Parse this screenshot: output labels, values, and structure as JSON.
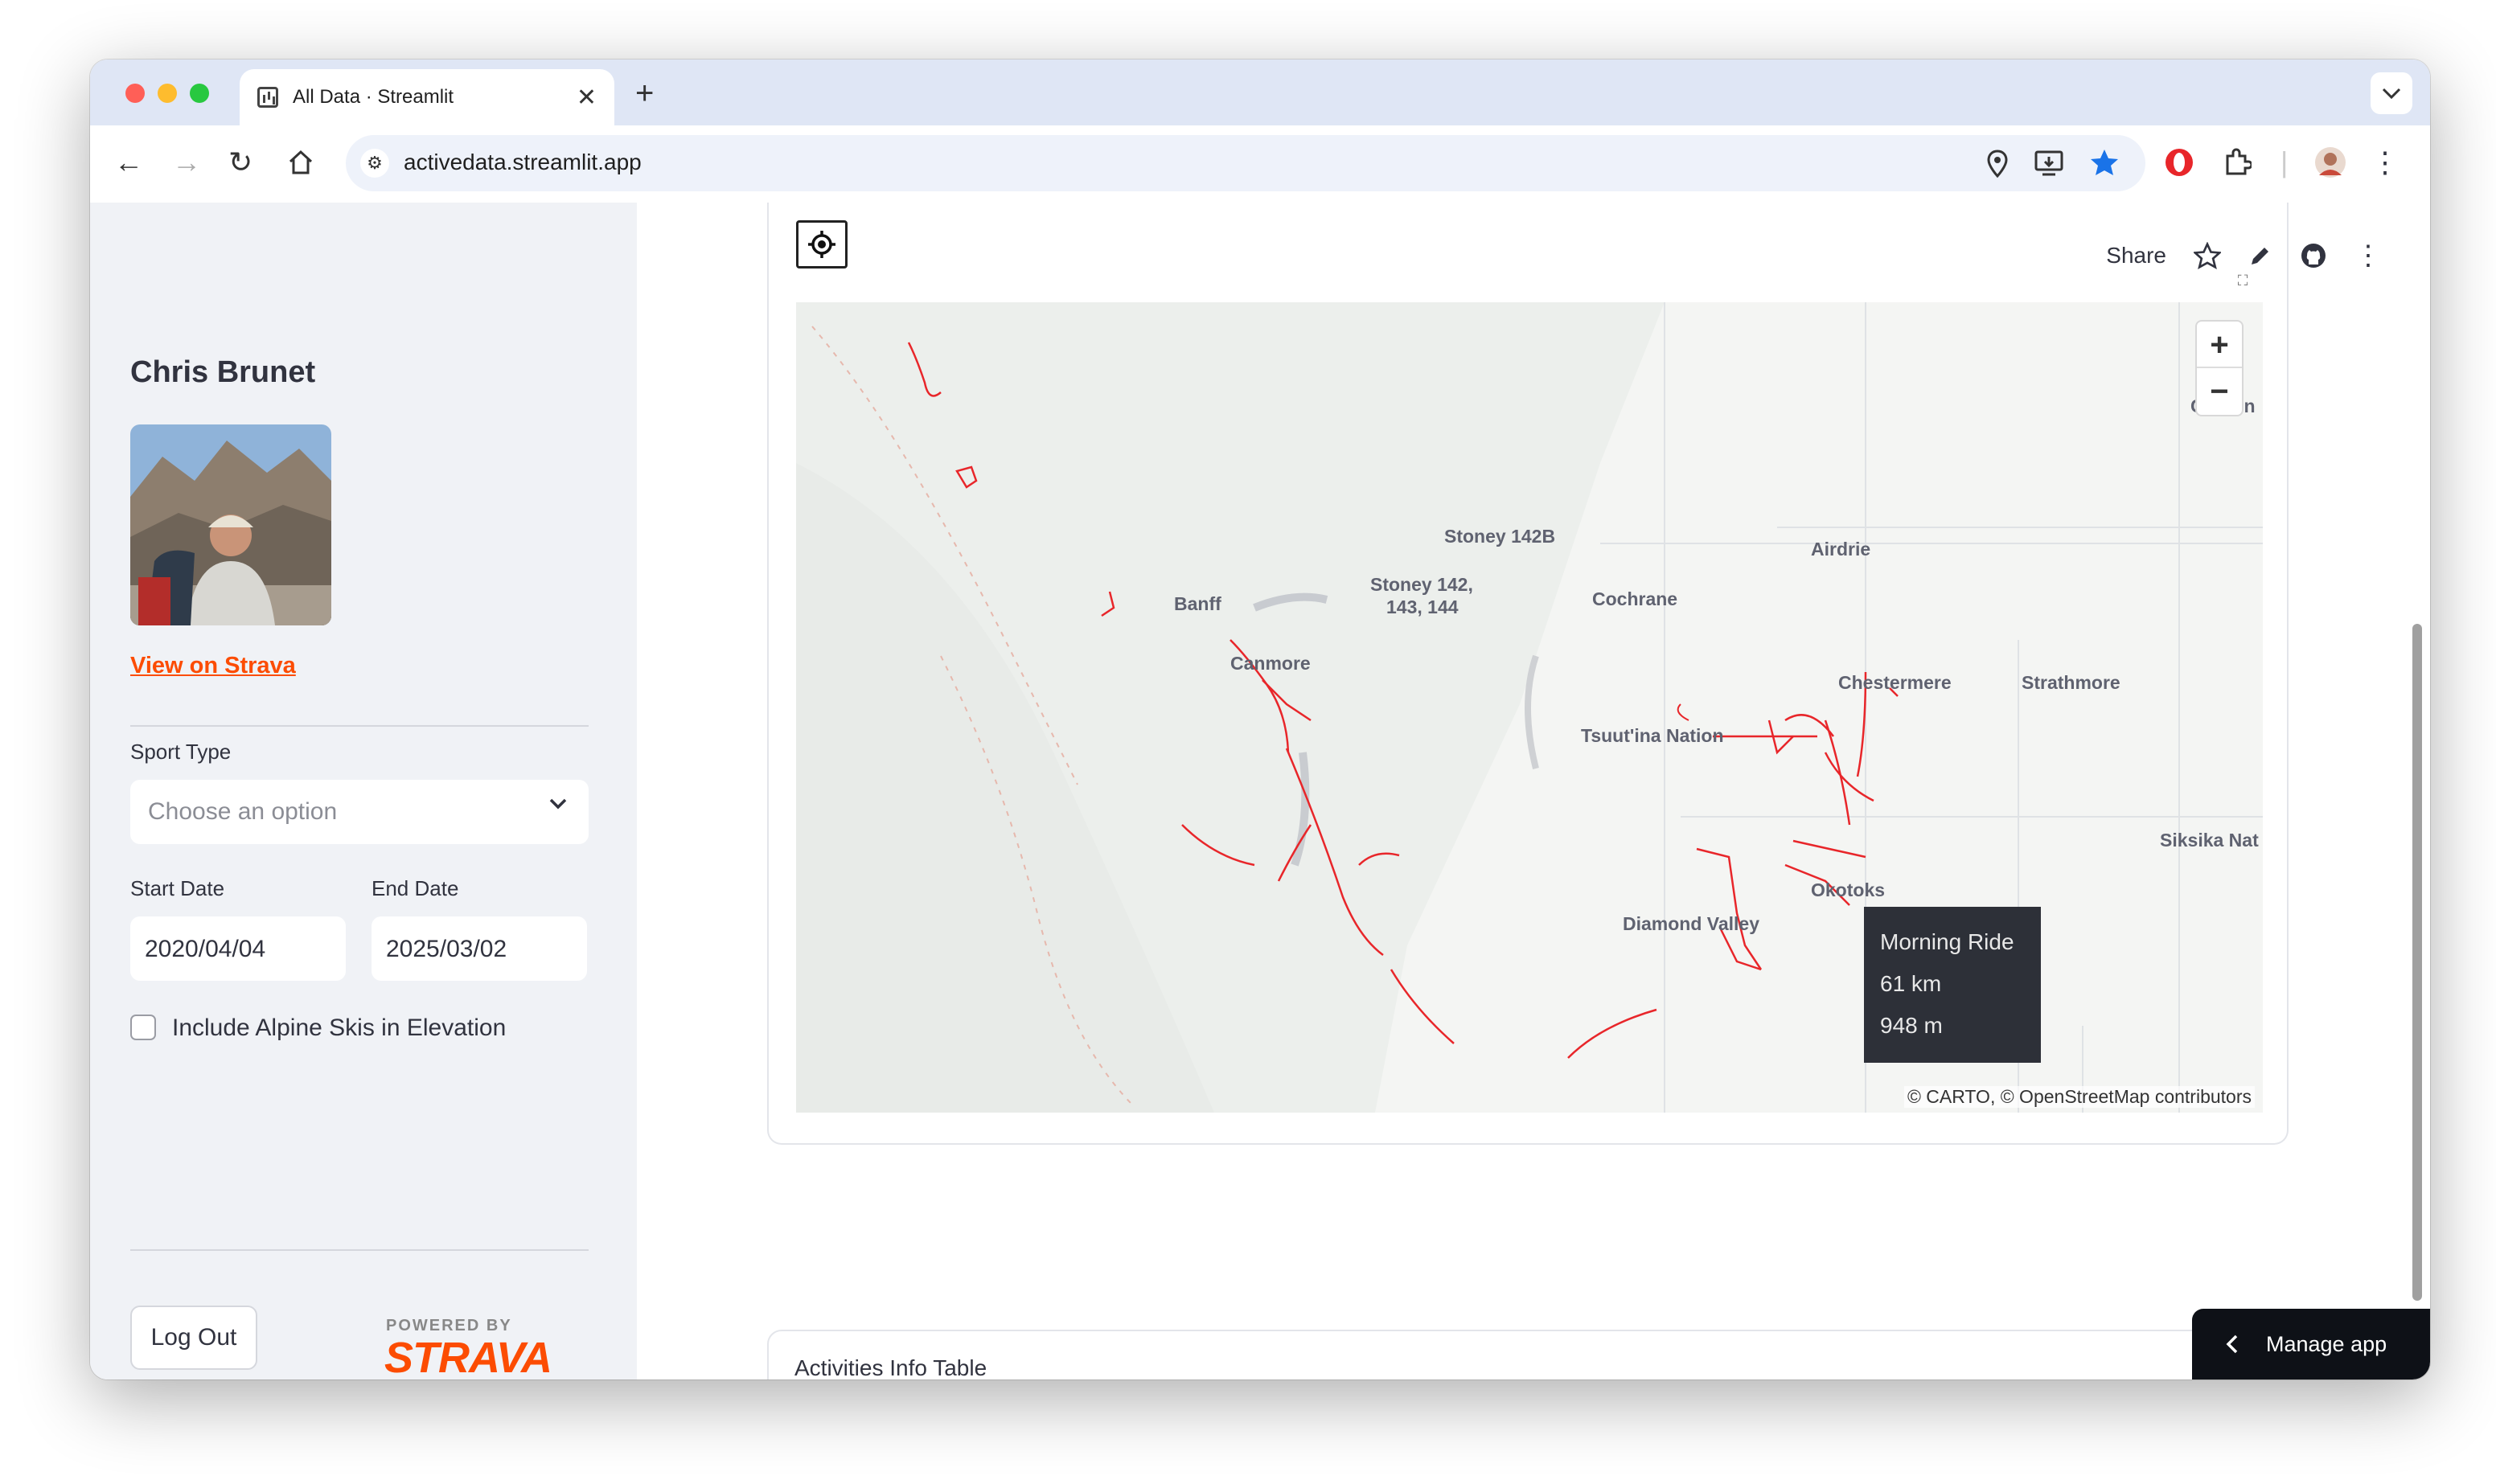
{
  "browser": {
    "tab_title": "All Data · Streamlit",
    "tab_close": "✕",
    "new_tab": "+",
    "url": "activedata.streamlit.app",
    "tab_menu": "⌄"
  },
  "sidebar": {
    "athlete_name": "Chris Brunet",
    "strava_link": "View on Strava",
    "sport_type_label": "Sport Type",
    "sport_type_placeholder": "Choose an option",
    "start_date_label": "Start Date",
    "start_date_value": "2020/04/04",
    "end_date_label": "End Date",
    "end_date_value": "2025/03/02",
    "alpine_checkbox_label": "Include Alpine Skis in Elevation",
    "alpine_checked": false,
    "logout_label": "Log Out",
    "powered_by": "POWERED BY",
    "strava_logo": "STRAVA"
  },
  "header": {
    "share_label": "Share"
  },
  "map": {
    "zoom_in": "+",
    "zoom_out": "−",
    "attribution": "© CARTO, © OpenStreetMap contributors",
    "places": [
      "Carbon",
      "Stoney 142B",
      "Airdrie",
      "Stoney 142,",
      "143, 144",
      "Cochrane",
      "Banff",
      "Canmore",
      "Chestermere",
      "Strathmore",
      "Tsuut'ina Nation",
      "Siksika Nat",
      "Okotoks",
      "Diamond Valley"
    ],
    "tooltip": {
      "title": "Morning Ride",
      "distance": "61 km",
      "elevation": "948 m"
    }
  },
  "activities_table_label": "Activities Info Table",
  "manage_app_label": "Manage app",
  "colors": {
    "accent": "#fc4c02",
    "route": "#e8262a",
    "sidebar_bg": "#f0f2f6"
  }
}
